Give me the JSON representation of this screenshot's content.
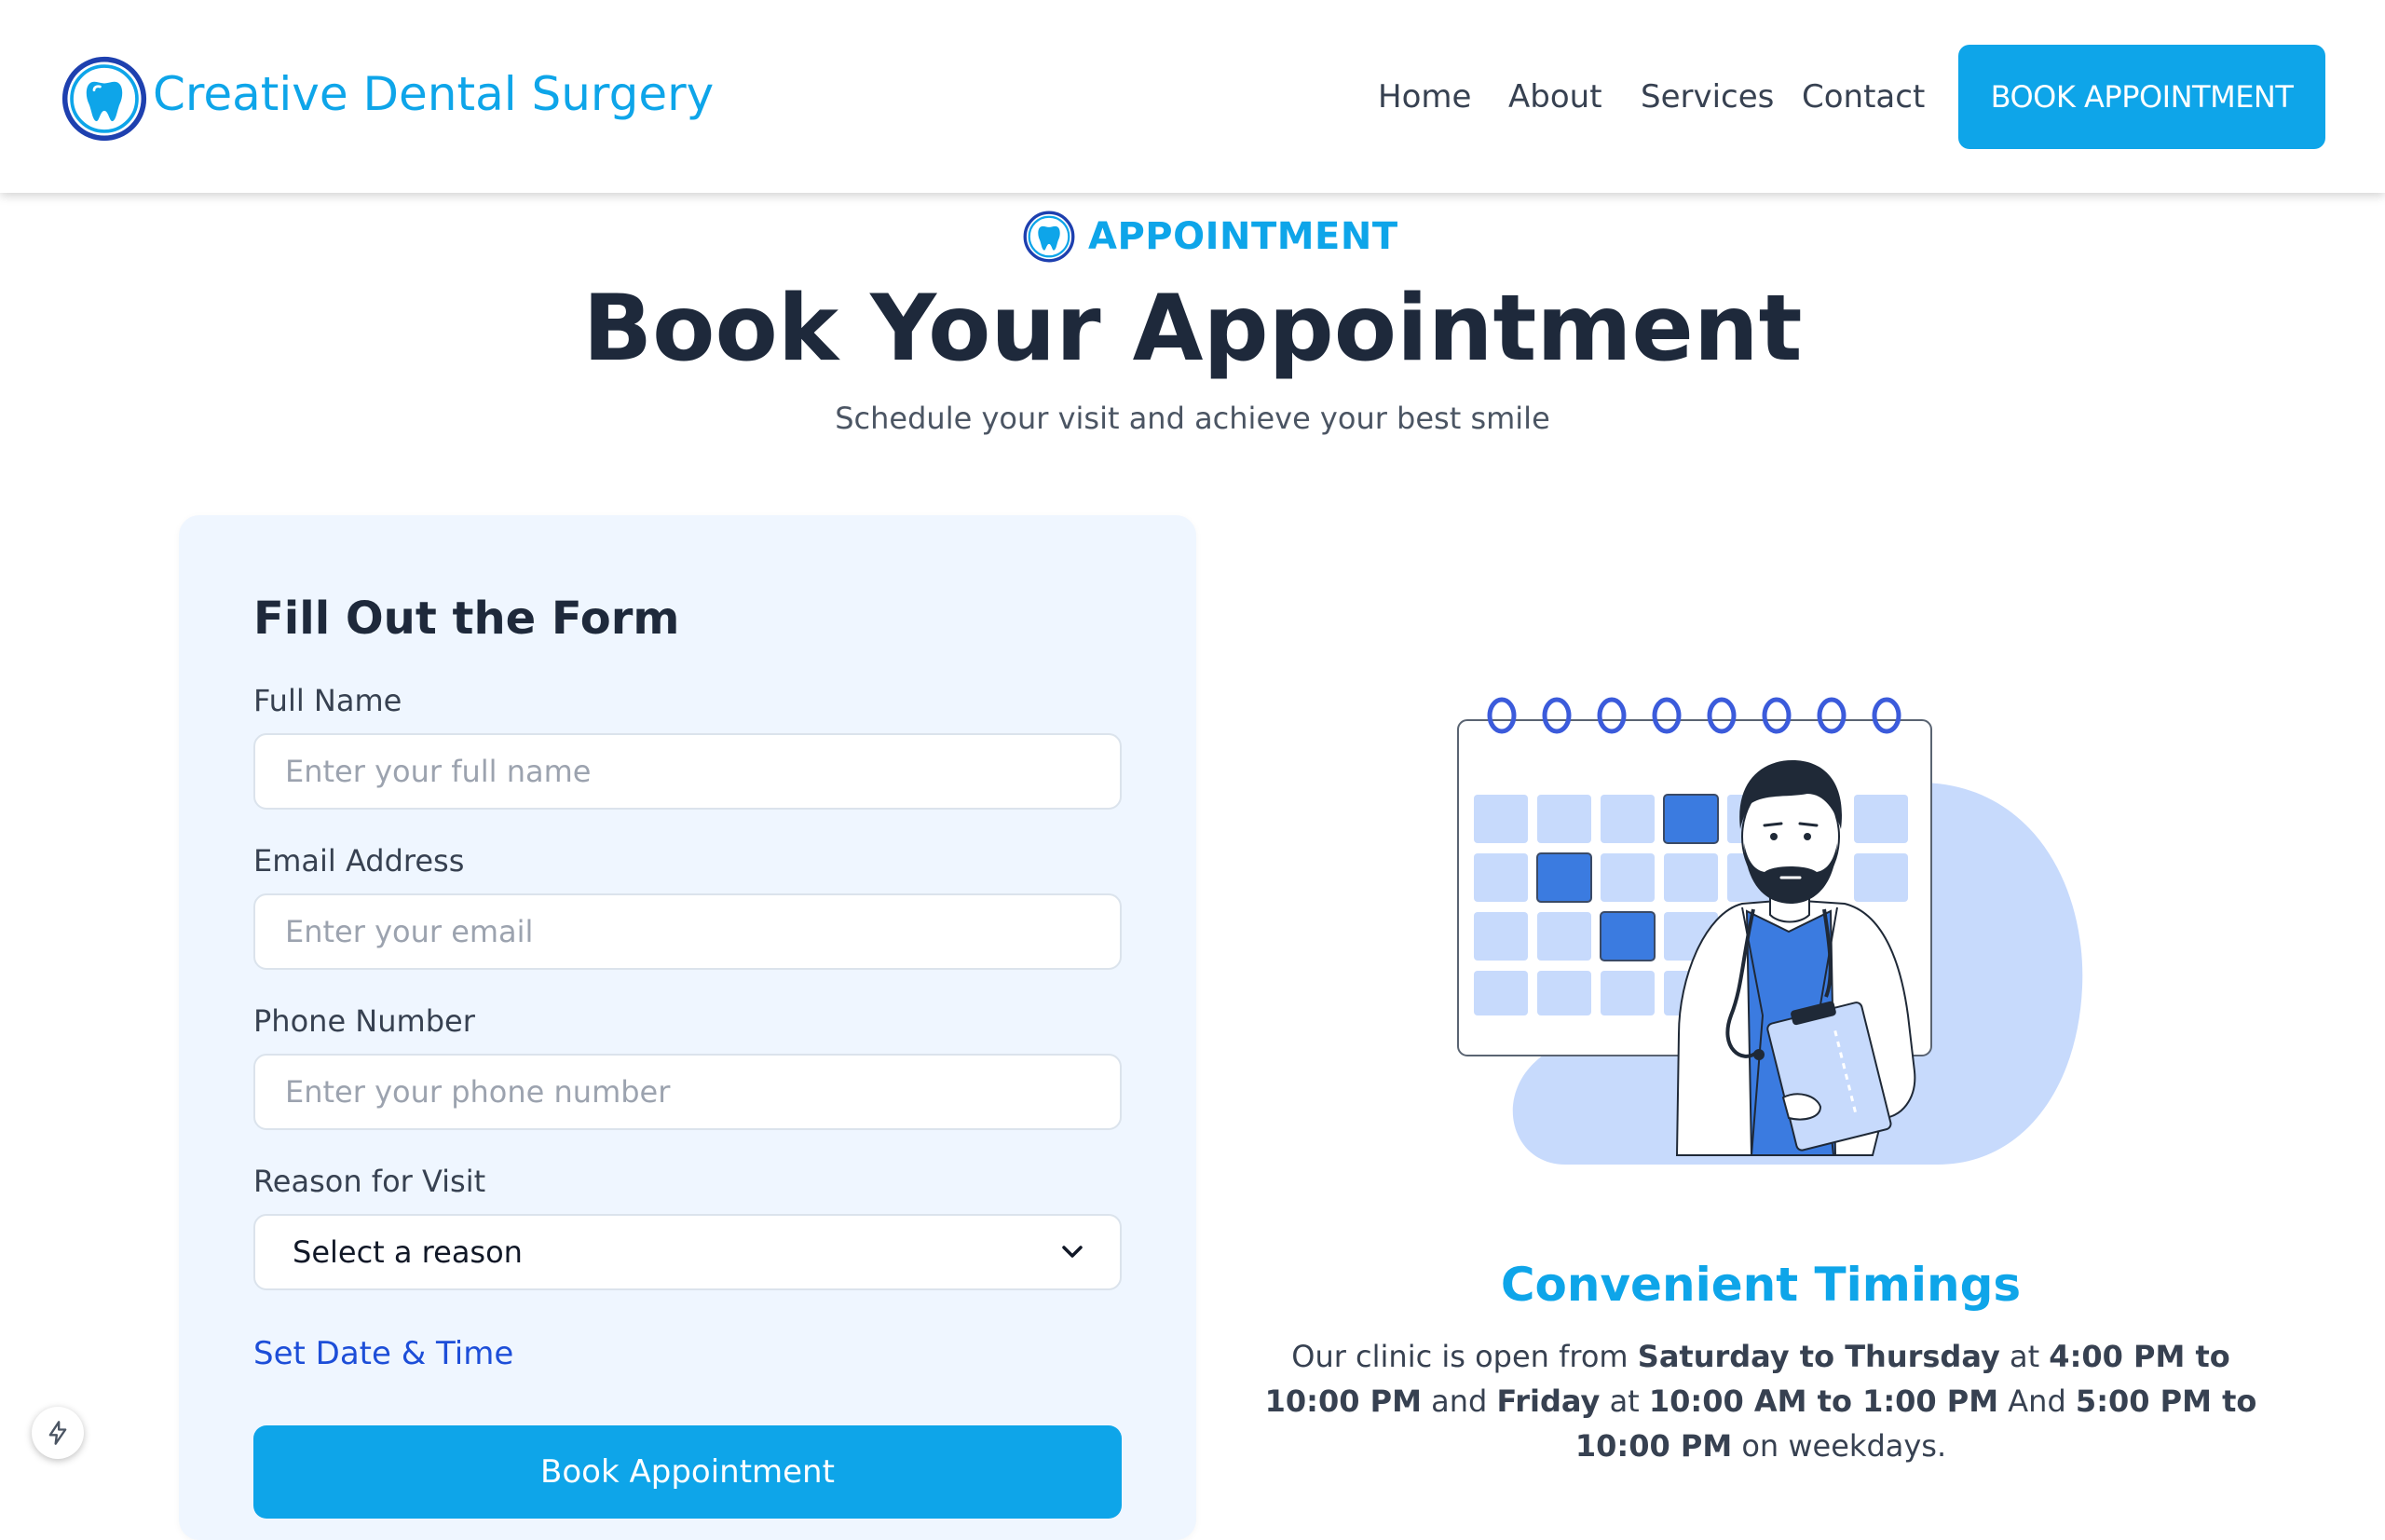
{
  "header": {
    "brand": "Creative Dental Surgery",
    "logo_icon": "tooth-icon",
    "nav": [
      {
        "label": "Home"
      },
      {
        "label": "About"
      },
      {
        "label": "Services"
      },
      {
        "label": "Contact"
      }
    ],
    "cta_label": "BOOK APPOINTMENT"
  },
  "section": {
    "tag": "APPOINTMENT",
    "title": "Book Your Appointment",
    "subtitle": "Schedule your visit and achieve your best smile"
  },
  "form": {
    "title": "Fill Out the Form",
    "fields": {
      "full_name": {
        "label": "Full Name",
        "placeholder": "Enter your full name"
      },
      "email": {
        "label": "Email Address",
        "placeholder": "Enter your email"
      },
      "phone": {
        "label": "Phone Number",
        "placeholder": "Enter your phone number"
      },
      "reason": {
        "label": "Reason for Visit",
        "selected": "Select a reason"
      }
    },
    "set_datetime_label": "Set Date & Time",
    "submit_label": "Book Appointment"
  },
  "timings": {
    "title": "Convenient Timings",
    "t1": "Our clinic is open from ",
    "b1": "Saturday to Thursday",
    "t2": " at ",
    "b2": "4:00 PM to 10:00 PM",
    "t3": " and ",
    "b3": "Friday",
    "t4": " at ",
    "b4": "10:00 AM to 1:00 PM",
    "t5": " And ",
    "b5": "5:00 PM to 10:00 PM",
    "t6": " on weekdays."
  },
  "colors": {
    "accent": "#0ea5e9",
    "title": "#1e293b",
    "card_bg": "#eff6ff",
    "link": "#1d4ed8"
  },
  "icons": {
    "illustration": "doctor-calendar-illustration",
    "chevron": "chevron-down-icon",
    "badge": "lightning-icon"
  }
}
